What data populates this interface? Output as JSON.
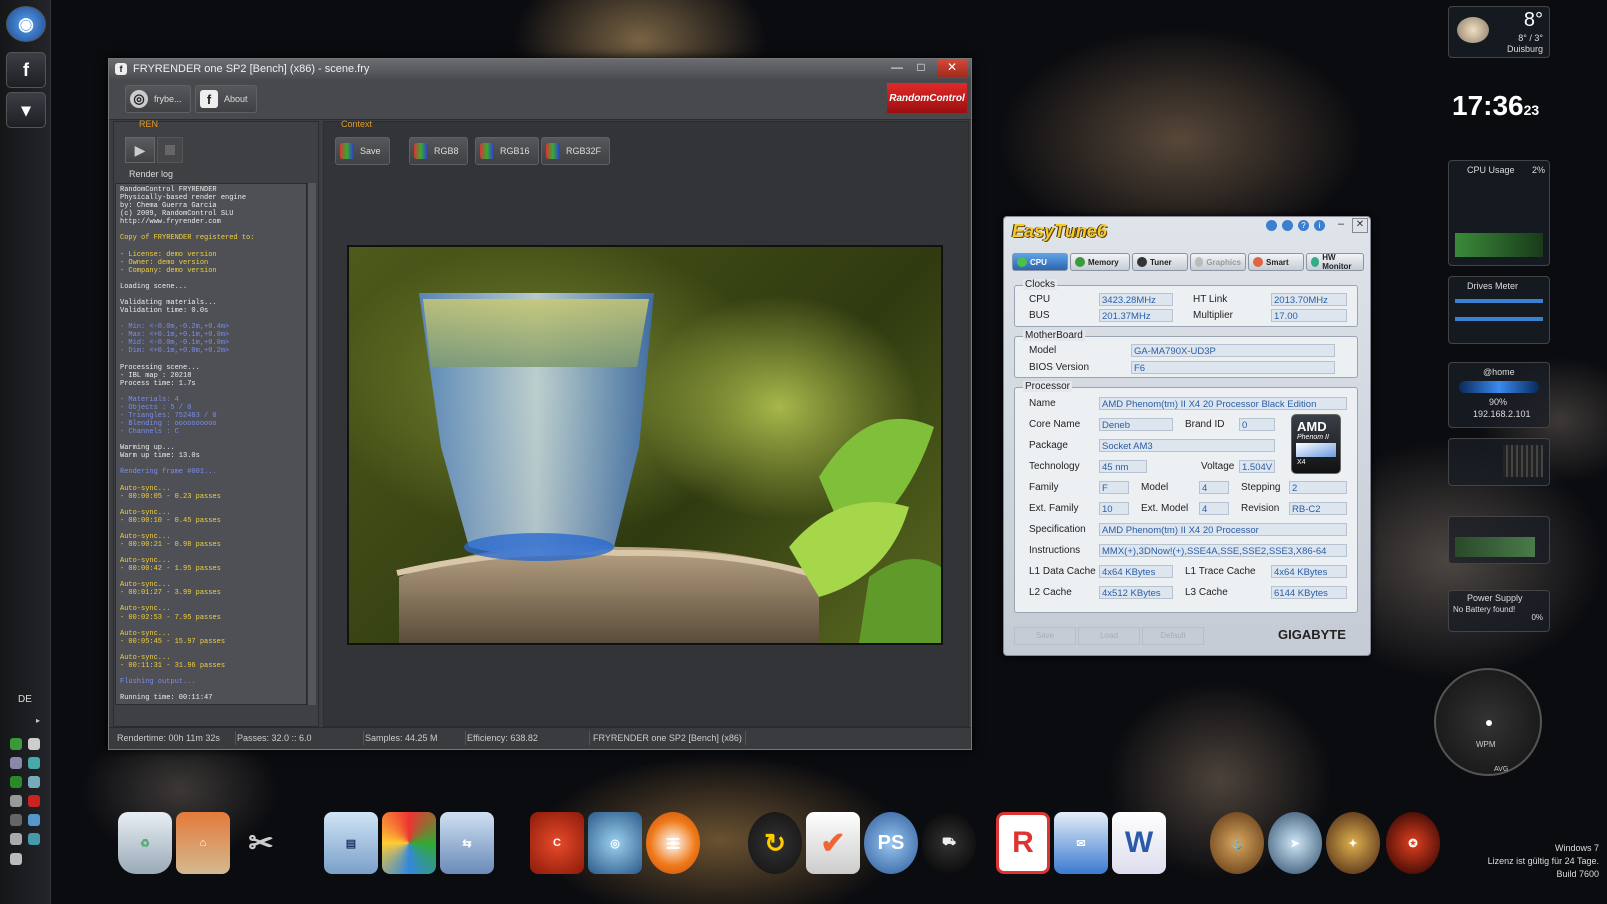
{
  "window": {
    "title": "FRYRENDER one SP2 [Bench] (x86) - scene.fry",
    "minimize": "—",
    "maximize": "□",
    "close": "✕"
  },
  "toolbar": {
    "frybe_label": "frybe...",
    "about_label": "About",
    "brand": "RandomControl"
  },
  "tabs": {
    "ren": "REN",
    "context": "Context"
  },
  "context_buttons": {
    "save": "Save",
    "rgb8": "RGB8",
    "rgb16": "RGB16",
    "rgb32f": "RGB32F"
  },
  "render_log_label": "Render log",
  "log_lines": [
    {
      "t": "RandomControl FRYRENDER",
      "c": "w"
    },
    {
      "t": "Physically-based render engine",
      "c": "w"
    },
    {
      "t": "by: Chema Guerra Garcia",
      "c": "w"
    },
    {
      "t": "(c) 2009, RandomControl SLU",
      "c": "w"
    },
    {
      "t": "http://www.fryrender.com",
      "c": "w"
    },
    {
      "t": "",
      "c": "w"
    },
    {
      "t": "Copy of FRYRENDER registered to:",
      "c": "y"
    },
    {
      "t": "",
      "c": "w"
    },
    {
      "t": "- License: demo version",
      "c": "y"
    },
    {
      "t": "- Owner:   demo version",
      "c": "y"
    },
    {
      "t": "- Company: demo version",
      "c": "y"
    },
    {
      "t": "",
      "c": "w"
    },
    {
      "t": "Loading scene...",
      "c": "w"
    },
    {
      "t": "",
      "c": "w"
    },
    {
      "t": "Validating materials...",
      "c": "w"
    },
    {
      "t": "Validation time: 0.0s",
      "c": "w"
    },
    {
      "t": "",
      "c": "w"
    },
    {
      "t": "- Min: <-0.0m,-0.2m,+0.4m>",
      "c": "b"
    },
    {
      "t": "- Max: <+0.1m,+0.1m,+0.0m>",
      "c": "b"
    },
    {
      "t": "- Mid: <-0.0m,-0.1m,+0.0m>",
      "c": "b"
    },
    {
      "t": "- Dim: <+0.1m,+0.0m,+0.2m>",
      "c": "b"
    },
    {
      "t": "",
      "c": "w"
    },
    {
      "t": "Processing scene...",
      "c": "w"
    },
    {
      "t": "- IBL map  : 20218",
      "c": "w"
    },
    {
      "t": "Process time: 1.7s",
      "c": "w"
    },
    {
      "t": "",
      "c": "w"
    },
    {
      "t": "- Materials: 4",
      "c": "b"
    },
    {
      "t": "- Objects  : 5 / 0",
      "c": "b"
    },
    {
      "t": "- Triangles: 752483 / 0",
      "c": "b"
    },
    {
      "t": "- Blending : oooooooooo",
      "c": "b"
    },
    {
      "t": "- Channels : C",
      "c": "b"
    },
    {
      "t": "",
      "c": "w"
    },
    {
      "t": "Warming up...",
      "c": "w"
    },
    {
      "t": "Warm up time: 13.0s",
      "c": "w"
    },
    {
      "t": "",
      "c": "w"
    },
    {
      "t": "Rendering frame #001...",
      "c": "b"
    },
    {
      "t": "",
      "c": "w"
    },
    {
      "t": "Auto-sync...",
      "c": "y"
    },
    {
      "t": "- 00:00:05 - 0.23 passes",
      "c": "y"
    },
    {
      "t": "",
      "c": "w"
    },
    {
      "t": "Auto-sync...",
      "c": "y"
    },
    {
      "t": "- 00:00:10 - 0.45 passes",
      "c": "y"
    },
    {
      "t": "",
      "c": "w"
    },
    {
      "t": "Auto-sync...",
      "c": "y"
    },
    {
      "t": "- 00:00:21 - 0.98 passes",
      "c": "y"
    },
    {
      "t": "",
      "c": "w"
    },
    {
      "t": "Auto-sync...",
      "c": "y"
    },
    {
      "t": "- 00:00:42 - 1.95 passes",
      "c": "y"
    },
    {
      "t": "",
      "c": "w"
    },
    {
      "t": "Auto-sync...",
      "c": "y"
    },
    {
      "t": "- 00:01:27 - 3.99 passes",
      "c": "y"
    },
    {
      "t": "",
      "c": "w"
    },
    {
      "t": "Auto-sync...",
      "c": "y"
    },
    {
      "t": "- 00:02:53 - 7.95 passes",
      "c": "y"
    },
    {
      "t": "",
      "c": "w"
    },
    {
      "t": "Auto-sync...",
      "c": "y"
    },
    {
      "t": "- 00:05:45 - 15.97 passes",
      "c": "y"
    },
    {
      "t": "",
      "c": "w"
    },
    {
      "t": "Auto-sync...",
      "c": "y"
    },
    {
      "t": "- 00:11:31 - 31.96 passes",
      "c": "y"
    },
    {
      "t": "",
      "c": "w"
    },
    {
      "t": "Flushing output...",
      "c": "b"
    },
    {
      "t": "",
      "c": "w"
    },
    {
      "t": "Running time: 00:11:47",
      "c": "w"
    }
  ],
  "status": {
    "rendertime": "Rendertime: 00h 11m 32s",
    "passes": "Passes: 32.0 :: 6.0",
    "samples": "Samples: 44.25 M",
    "efficiency": "Efficiency: 638.82",
    "product": "FRYRENDER one SP2 [Bench] (x86)"
  },
  "easytune": {
    "logo": "EasyTune6",
    "tabs": [
      "CPU",
      "Memory",
      "Tuner",
      "Graphics",
      "Smart",
      "HW Monitor"
    ],
    "clocks": {
      "title": "Clocks",
      "cpu_label": "CPU",
      "cpu": "3423.28MHz",
      "ht_label": "HT Link",
      "ht": "2013.70MHz",
      "bus_label": "BUS",
      "bus": "201.37MHz",
      "mult_label": "Multiplier",
      "mult": "17.00"
    },
    "motherboard": {
      "title": "MotherBoard",
      "model_label": "Model",
      "model": "GA-MA790X-UD3P",
      "bios_label": "BIOS Version",
      "bios": "F6"
    },
    "processor": {
      "title": "Processor",
      "name_label": "Name",
      "name": "AMD Phenom(tm) II X4 20 Processor Black Edition",
      "core_label": "Core Name",
      "core": "Deneb",
      "brand_label": "Brand ID",
      "brand": "0",
      "package_label": "Package",
      "package": "Socket AM3",
      "tech_label": "Technology",
      "tech": "45 nm",
      "volt_label": "Voltage",
      "volt": "1.504V",
      "family_label": "Family",
      "family": "F",
      "model_label": "Model",
      "model": "4",
      "stepping_label": "Stepping",
      "stepping": "2",
      "extfam_label": "Ext. Family",
      "extfam": "10",
      "extmodel_label": "Ext. Model",
      "extmodel": "4",
      "revision_label": "Revision",
      "revision": "RB-C2",
      "spec_label": "Specification",
      "spec": "AMD Phenom(tm) II X4 20 Processor",
      "instr_label": "Instructions",
      "instr": "MMX(+),3DNow!(+),SSE4A,SSE,SSE2,SSE3,X86-64",
      "l1d_label": "L1 Data Cache",
      "l1d": "4x64 KBytes",
      "l1t_label": "L1 Trace Cache",
      "l1t": "4x64 KBytes",
      "l2_label": "L2 Cache",
      "l2": "4x512 KBytes",
      "l3_label": "L3 Cache",
      "l3": "6144 KBytes"
    },
    "footer_buttons": [
      "Save",
      "Load",
      "Default"
    ],
    "brand": "GIGABYTE"
  },
  "amd_logo": {
    "line1": "AMD",
    "line2": "Phenom II",
    "line3": "X4"
  },
  "gadgets": {
    "weather": {
      "temp": "8°",
      "range": "8° / 3°",
      "city": "Duisburg"
    },
    "clock": {
      "time": "17:36",
      "seconds": "23"
    },
    "cpu_usage": {
      "title": "CPU Usage",
      "value": "2%"
    },
    "drives": {
      "title": "Drives Meter"
    },
    "network": {
      "title": "@home",
      "signal": "90%",
      "ip": "192.168.2.101"
    },
    "power": {
      "title": "Power Supply",
      "status": "No Battery found!",
      "pct": "0%"
    },
    "speedo": {
      "unit": "WPM",
      "mode": "AVG"
    }
  },
  "left_bar": {
    "lang": "DE"
  },
  "watermark": {
    "line1": "Windows 7",
    "line2": "Lizenz ist gültig für 24 Tage.",
    "line3": "Build 7600"
  }
}
